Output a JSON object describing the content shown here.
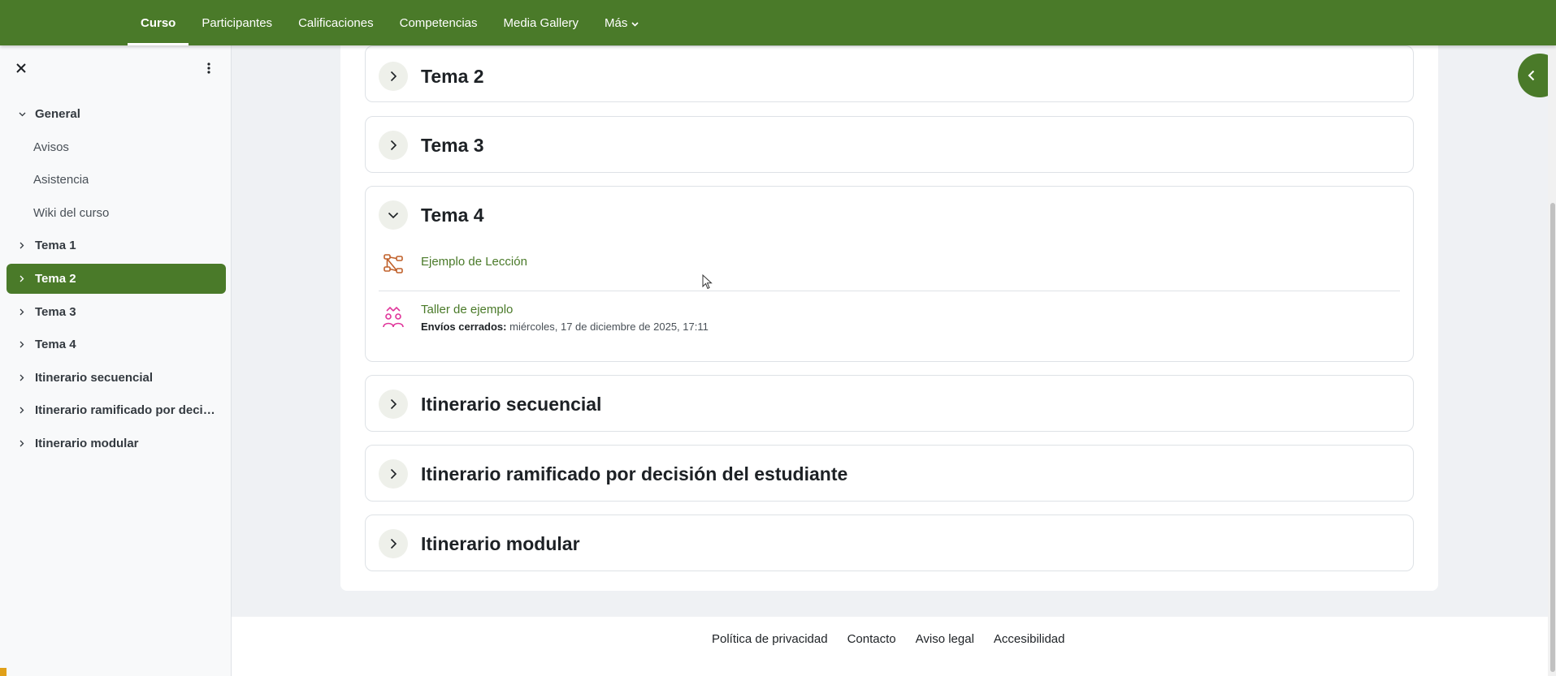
{
  "topnav": {
    "tabs": [
      {
        "label": "Curso",
        "active": true
      },
      {
        "label": "Participantes"
      },
      {
        "label": "Calificaciones"
      },
      {
        "label": "Competencias"
      },
      {
        "label": "Media Gallery"
      },
      {
        "label": "Más"
      }
    ]
  },
  "drawer": {
    "items": [
      {
        "label": "General",
        "type": "section",
        "expanded": true
      },
      {
        "label": "Avisos",
        "type": "sub"
      },
      {
        "label": "Asistencia",
        "type": "sub"
      },
      {
        "label": "Wiki del curso",
        "type": "sub"
      },
      {
        "label": "Tema 1",
        "type": "section"
      },
      {
        "label": "Tema 2",
        "type": "section",
        "active": true
      },
      {
        "label": "Tema 3",
        "type": "section"
      },
      {
        "label": "Tema 4",
        "type": "section"
      },
      {
        "label": "Itinerario secuencial",
        "type": "section"
      },
      {
        "label": "Itinerario ramificado por decisión del estudiante",
        "type": "section"
      },
      {
        "label": "Itinerario modular",
        "type": "section"
      }
    ]
  },
  "sections": [
    {
      "title": "Tema 2",
      "expanded": false
    },
    {
      "title": "Tema 3",
      "expanded": false
    },
    {
      "title": "Tema 4",
      "expanded": true
    },
    {
      "title": "Itinerario secuencial",
      "expanded": false
    },
    {
      "title": "Itinerario ramificado por decisión del estudiante",
      "expanded": false
    },
    {
      "title": "Itinerario modular",
      "expanded": false
    }
  ],
  "tema4_activities": [
    {
      "name": "Ejemplo de Lección",
      "icon": "lesson-icon"
    },
    {
      "name": "Taller de ejemplo",
      "icon": "workshop-icon",
      "meta_label": "Envíos cerrados:",
      "meta_value": " miércoles, 17 de diciembre de 2025, 17:11"
    }
  ],
  "footer": {
    "links": [
      "Política de privacidad",
      "Contacto",
      "Aviso legal",
      "Accesibilidad"
    ]
  },
  "colors": {
    "brand": "#4a7a29",
    "lesson_icon": "#c0602a",
    "workshop_icon": "#e0359a"
  }
}
